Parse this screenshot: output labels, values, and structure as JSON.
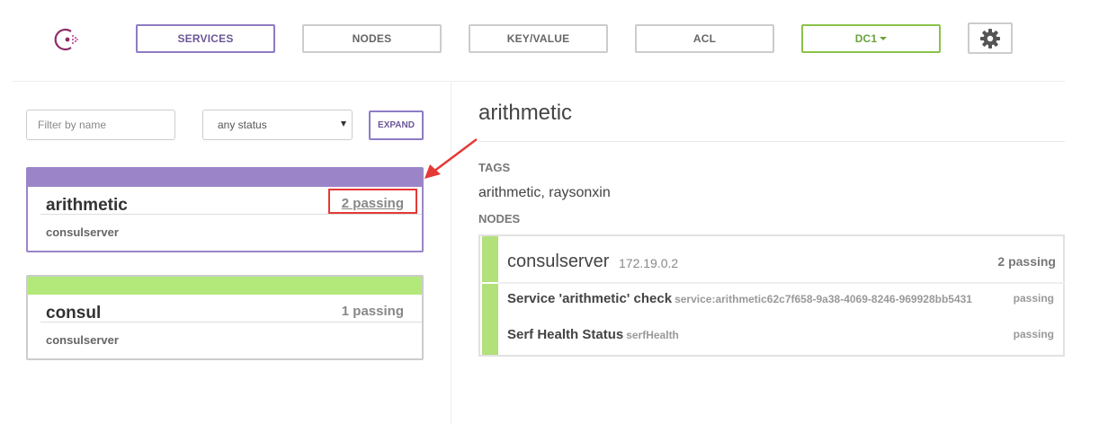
{
  "nav": {
    "services": "SERVICES",
    "nodes": "NODES",
    "keyvalue": "KEY/VALUE",
    "acl": "ACL",
    "datacenter": "DC1",
    "brand_color": "#8e7cc3",
    "dc_color": "#8ac34a"
  },
  "filters": {
    "name_placeholder": "Filter by name",
    "name_value": "",
    "status_selected": "any status",
    "expand_label": "EXPAND"
  },
  "services": [
    {
      "name": "arithmetic",
      "passing": "2 passing",
      "node": "consulserver",
      "bar_color": "#9b85c8",
      "selected": true
    },
    {
      "name": "consul",
      "passing": "1 passing",
      "node": "consulserver",
      "bar_color": "#b2e97a",
      "selected": false
    }
  ],
  "detail": {
    "title": "arithmetic",
    "tags_label": "TAGS",
    "tags_value": "arithmetic, raysonxin",
    "nodes_label": "NODES",
    "node": {
      "name": "consulserver",
      "ip": "172.19.0.2",
      "passing": "2 passing",
      "stripe_color": "#b2e07a",
      "checks": [
        {
          "name": "Service 'arithmetic' check",
          "id": "service:arithmetic62c7f658-9a38-4069-8246-969928bb5431",
          "status": "passing"
        },
        {
          "name": "Serf Health Status",
          "id": "serfHealth",
          "status": "passing"
        }
      ]
    }
  },
  "annotation": {
    "highlight_color": "#e53935"
  }
}
